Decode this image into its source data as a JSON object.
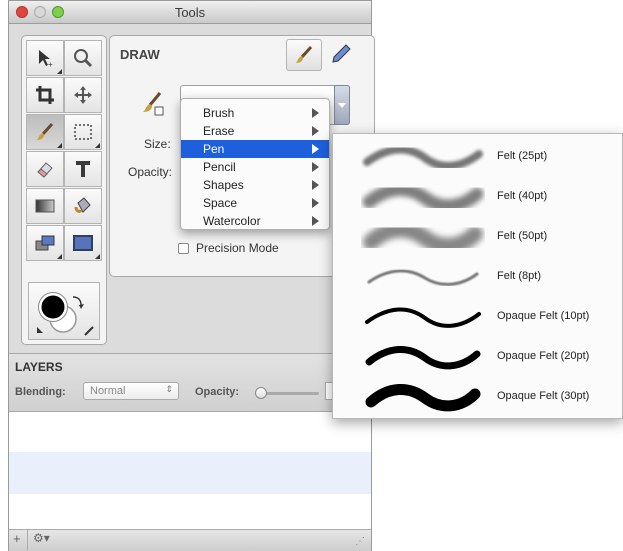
{
  "window": {
    "title": "Tools"
  },
  "draw_panel": {
    "heading": "DRAW",
    "size_label": "Size:",
    "opacity_label": "Opacity:",
    "precision_label": "Precision Mode"
  },
  "brush_menu": {
    "items": [
      {
        "label": "Brush"
      },
      {
        "label": "Erase"
      },
      {
        "label": "Pen"
      },
      {
        "label": "Pencil"
      },
      {
        "label": "Shapes"
      },
      {
        "label": "Space"
      },
      {
        "label": "Watercolor"
      }
    ],
    "active": "Pen"
  },
  "pen_submenu": {
    "items": [
      {
        "label": "Felt (25pt)",
        "stroke": "soft-thin"
      },
      {
        "label": "Felt (40pt)",
        "stroke": "soft-medium"
      },
      {
        "label": "Felt (50pt)",
        "stroke": "soft-thick"
      },
      {
        "label": "Felt (8pt)",
        "stroke": "soft-hairline"
      },
      {
        "label": "Opaque Felt (10pt)",
        "stroke": "solid-thin"
      },
      {
        "label": "Opaque Felt (20pt)",
        "stroke": "solid-medium"
      },
      {
        "label": "Opaque Felt (30pt)",
        "stroke": "solid-thick"
      }
    ]
  },
  "layers": {
    "heading": "LAYERS",
    "blending_label": "Blending:",
    "blending_value": "Normal",
    "opacity_label": "Opacity:"
  },
  "colors": {
    "accent": "#1e5fdc",
    "selection_row": "#eaf0fb"
  }
}
